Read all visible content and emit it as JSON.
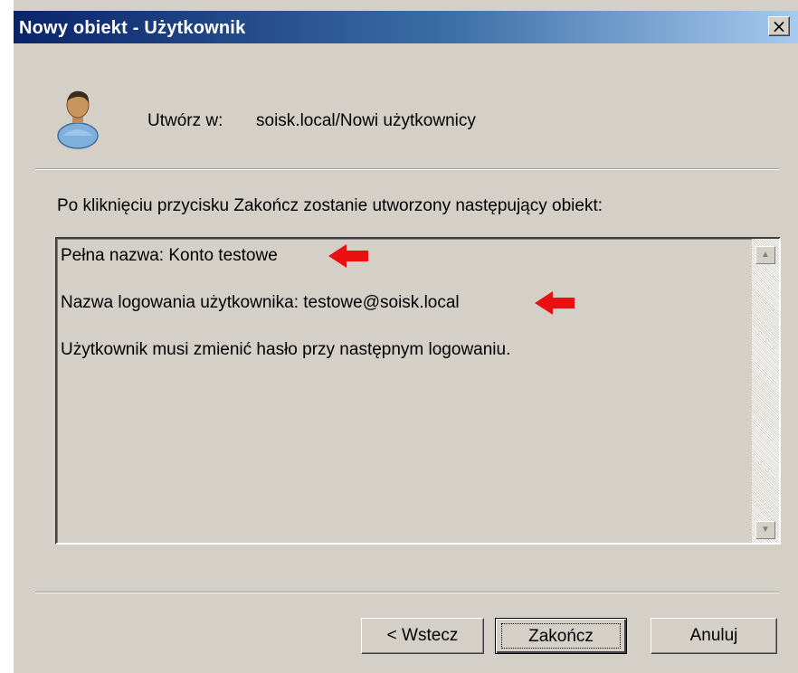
{
  "window": {
    "title": "Nowy obiekt - Użytkownik",
    "close_glyph": "×"
  },
  "header": {
    "icon": "user-icon",
    "create_label": "Utwórz w:",
    "create_path": "soisk.local/Nowi użytkownicy"
  },
  "info": {
    "text": "Po kliknięciu przycisku Zakończ zostanie utworzony następujący obiekt:"
  },
  "summary": {
    "lines": [
      "Pełna nazwa: Konto testowe",
      "Nazwa logowania użytkownika: testowe@soisk.local",
      "Użytkownik musi zmienić hasło przy następnym logowaniu."
    ],
    "scroll_up_glyph": "▲",
    "scroll_down_glyph": "▼"
  },
  "annotations": {
    "arrow_color": "#e81010"
  },
  "buttons": {
    "back": "< Wstecz",
    "finish": "Zakończ",
    "cancel": "Anuluj"
  }
}
